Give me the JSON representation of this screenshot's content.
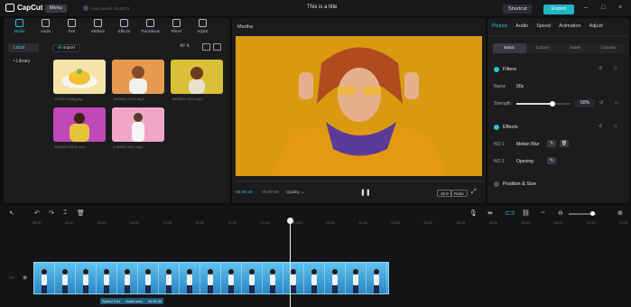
{
  "app": {
    "name": "CapCut",
    "menu": "Menu",
    "autosave": "Auto saved: 10:40:31",
    "title": "This is a title",
    "shortcut": "Shortcut",
    "export": "Export"
  },
  "toolbar": [
    {
      "label": "Media",
      "icon": "media-icon",
      "active": true
    },
    {
      "label": "Audio",
      "icon": "audio-icon"
    },
    {
      "label": "Text",
      "icon": "text-icon"
    },
    {
      "label": "Stickers",
      "icon": "stickers-icon"
    },
    {
      "label": "Effects",
      "icon": "effects-icon"
    },
    {
      "label": "Transitions",
      "icon": "transitions-icon"
    },
    {
      "label": "Filters",
      "icon": "filters-icon"
    },
    {
      "label": "Adjust",
      "icon": "adjust-icon"
    }
  ],
  "leftnav": {
    "local": "Local",
    "library": "• Library"
  },
  "media": {
    "import": "Import",
    "all": "All",
    "thumbs": [
      {
        "caption": "1370270108.jpeg",
        "color": "#f6e3a8"
      },
      {
        "caption": "1603902-2021.mp4",
        "color": "#e59a4f"
      },
      {
        "caption": "1603902-2021.mp4",
        "color": "#d9c036"
      },
      {
        "caption": "1603902-2021.mp4",
        "color": "#c048b8"
      },
      {
        "caption": "1,16306 2021.mp4",
        "color": "#f0a7c6"
      }
    ]
  },
  "player": {
    "title": "Martha",
    "time_current": "00:00:40",
    "time_total": "00:07:00",
    "quality": "Quality",
    "ratio": "Ratio",
    "full": "16:9"
  },
  "right": {
    "tabs": [
      "Picture",
      "Audio",
      "Speed",
      "Animation",
      "Adjust"
    ],
    "subtabs": [
      "Basic",
      "Cutout",
      "Mask",
      "Canvas"
    ],
    "filters": {
      "title": "Filters",
      "name_label": "Name",
      "name_value": "90s",
      "strength_label": "Strength",
      "strength_value": "50%"
    },
    "effects": {
      "title": "Effects",
      "no1_label": "NO 1",
      "no1_value": "Motion Blur",
      "no2_label": "NO 2",
      "no2_value": "Opening"
    },
    "position": {
      "title": "Position & Size"
    }
  },
  "timeline": {
    "ruler": [
      "00:00",
      "00:10",
      "00:20",
      "00:30",
      "00:40",
      "00:50",
      "01:00",
      "01:10",
      "01:20",
      "01:30",
      "01:40",
      "01:50",
      "02:00",
      "02:10",
      "02:20",
      "02:30",
      "02:40",
      "02:50",
      "03:00"
    ],
    "clip_labels": [
      "Speed 2.0x",
      "Audio.wav",
      "00:00:40"
    ]
  },
  "colors": {
    "accent": "#2bc1d4",
    "bg": "#0e0e10",
    "panel": "#1c1c1f"
  }
}
